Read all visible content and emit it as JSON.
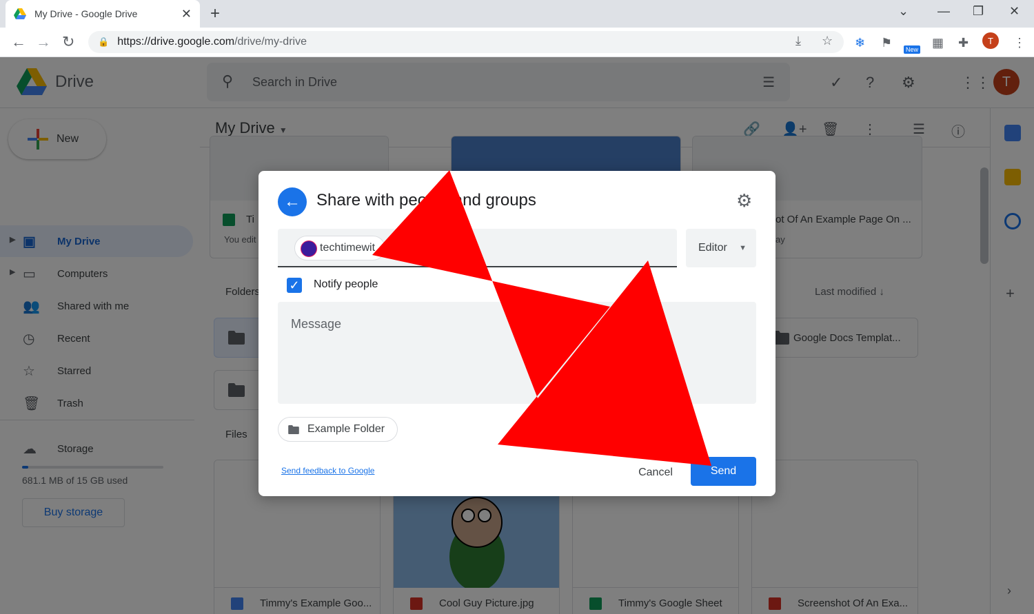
{
  "browser": {
    "tab_title": "My Drive - Google Drive",
    "url_host": "https://drive.google.com",
    "url_path": "/drive/my-drive",
    "profile_initial": "T",
    "ext_badge": "New"
  },
  "header": {
    "logo_text": "Drive",
    "search_placeholder": "Search in Drive",
    "avatar_initial": "T"
  },
  "sidebar": {
    "new_label": "New",
    "items": [
      {
        "label": "My Drive",
        "icon": "my-drive-icon",
        "active": true
      },
      {
        "label": "Computers",
        "icon": "computers-icon"
      },
      {
        "label": "Shared with me",
        "icon": "shared-icon"
      },
      {
        "label": "Recent",
        "icon": "clock-icon"
      },
      {
        "label": "Starred",
        "icon": "star-icon"
      },
      {
        "label": "Trash",
        "icon": "trash-icon"
      }
    ],
    "storage_label": "Storage",
    "storage_used": "681.1 MB of 15 GB used",
    "storage_fraction": 0.045,
    "buy_storage": "Buy storage"
  },
  "main": {
    "title": "My Drive",
    "folders_label": "Folders",
    "files_label": "Files",
    "sort_label": "Last modified",
    "suggested": [
      {
        "name": "Ti",
        "sub": "You edit"
      },
      {
        "name": "ot Of An Example Page On ...",
        "sub": "ay"
      }
    ],
    "folders": [
      {
        "name": ""
      },
      {
        "name": "Google Docs Templat..."
      },
      {
        "name": ""
      }
    ],
    "files": [
      {
        "name": "Timmy's Example Goo...",
        "color": "#4285f4"
      },
      {
        "name": "Cool Guy Picture.jpg",
        "color": "#d93025"
      },
      {
        "name": "Timmy's Google Sheet",
        "color": "#0f9d58"
      },
      {
        "name": "Screenshot Of An Exa...",
        "color": "#d93025"
      }
    ]
  },
  "dialog": {
    "title": "Share with people and groups",
    "recipient": "techtimewit",
    "role": "Editor",
    "notify_label": "Notify people",
    "notify_checked": true,
    "message_placeholder": "Message",
    "folder_chip": "Example Folder",
    "feedback_link": "Send feedback to Google",
    "cancel_label": "Cancel",
    "send_label": "Send"
  },
  "colors": {
    "accent": "#1a73e8",
    "arrow": "#ff0000"
  }
}
